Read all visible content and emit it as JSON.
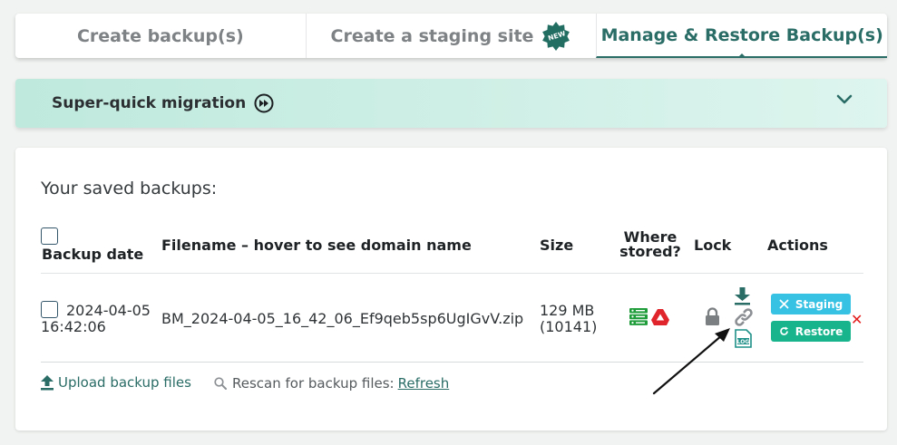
{
  "tabs": [
    {
      "label": "Create backup(s)",
      "active": false
    },
    {
      "label": "Create a staging site",
      "active": false,
      "badge": "NEW"
    },
    {
      "label": "Manage & Restore Backup(s)",
      "active": true
    }
  ],
  "migration": {
    "title": "Super-quick migration",
    "icon": "fast-forward-icon",
    "chevron": "chevron-down-icon"
  },
  "panel": {
    "title": "Your saved backups:",
    "columns": {
      "date": "Backup date",
      "filename": "Filename – hover to see domain name",
      "size": "Size",
      "where": "Where stored?",
      "lock": "Lock",
      "actions": "Actions"
    },
    "rows": [
      {
        "date": "2024-04-05",
        "time": "16:42:06",
        "filename": "BM_2024-04-05_16_42_06_Ef9qeb5sp6UgIGvV.zip",
        "size": "129 MB",
        "files": "(10141)",
        "storage_icons": [
          "server-icon",
          "google-drive-icon"
        ],
        "staging_label": "Staging",
        "restore_label": "Restore",
        "log_label": "LOG"
      }
    ],
    "footer": {
      "upload_label": "Upload backup files",
      "rescan_label": "Rescan for backup files:",
      "refresh_label": "Refresh"
    }
  },
  "colors": {
    "accent": "#2a6c66",
    "staging": "#37c1e3",
    "restore": "#18b58d",
    "delete": "#e31b1b"
  }
}
